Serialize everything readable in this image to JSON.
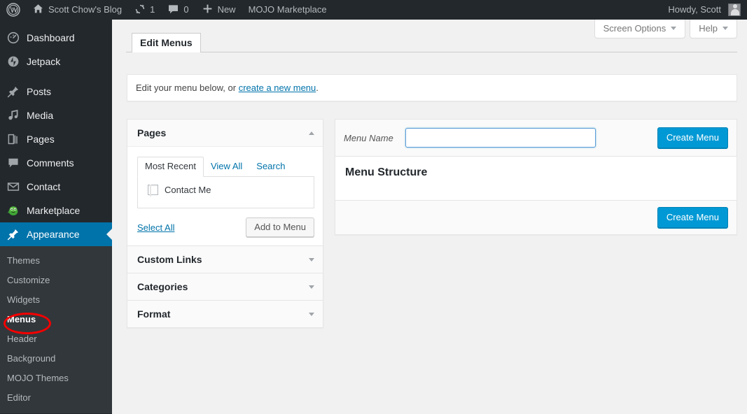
{
  "adminbar": {
    "logo_icon": "wordpress-logo-icon",
    "site_name": "Scott Chow's Blog",
    "home_icon": "home-icon",
    "updates_icon": "updates-icon",
    "updates_count": "1",
    "comments_icon": "comment-bubble-icon",
    "comments_count": "0",
    "new_icon": "plus-icon",
    "new_label": "New",
    "marketplace_label": "MOJO Marketplace",
    "howdy": "Howdy, Scott",
    "avatar_icon": "user-avatar-icon"
  },
  "sidebar": {
    "items": [
      {
        "label": "Dashboard",
        "icon": "dashboard-icon",
        "current": false
      },
      {
        "label": "Jetpack",
        "icon": "jetpack-icon",
        "current": false
      },
      {
        "label": "Posts",
        "icon": "pin-icon",
        "current": false
      },
      {
        "label": "Media",
        "icon": "media-icon",
        "current": false
      },
      {
        "label": "Pages",
        "icon": "pages-icon",
        "current": false
      },
      {
        "label": "Comments",
        "icon": "comment-icon",
        "current": false
      },
      {
        "label": "Contact",
        "icon": "envelope-icon",
        "current": false
      },
      {
        "label": "Marketplace",
        "icon": "marketplace-mascot-icon",
        "current": false
      },
      {
        "label": "Appearance",
        "icon": "paintbrush-icon",
        "current": true
      }
    ],
    "submenu": [
      {
        "label": "Themes",
        "current": false
      },
      {
        "label": "Customize",
        "current": false
      },
      {
        "label": "Widgets",
        "current": false
      },
      {
        "label": "Menus",
        "current": true
      },
      {
        "label": "Header",
        "current": false
      },
      {
        "label": "Background",
        "current": false
      },
      {
        "label": "MOJO Themes",
        "current": false
      },
      {
        "label": "Editor",
        "current": false
      }
    ],
    "annotation": {
      "target": "Menus",
      "color": "#f40000",
      "shape": "ellipse"
    }
  },
  "screen_meta": {
    "screen_options_label": "Screen Options",
    "help_label": "Help"
  },
  "tabs": [
    {
      "label": "Edit Menus",
      "active": true
    }
  ],
  "notice": {
    "text_before": "Edit your menu below, or ",
    "link": "create a new menu",
    "text_after": "."
  },
  "accordion": [
    {
      "title": "Pages",
      "open": true,
      "toggle_icon": "chevron-up-icon",
      "tabs": [
        {
          "label": "Most Recent",
          "active": true
        },
        {
          "label": "View All",
          "active": false
        },
        {
          "label": "Search",
          "active": false
        }
      ],
      "items": [
        {
          "label": "Contact Me",
          "checked": false
        }
      ],
      "select_all_label": "Select All",
      "add_to_menu_label": "Add to Menu"
    },
    {
      "title": "Custom Links",
      "open": false,
      "toggle_icon": "chevron-down-icon"
    },
    {
      "title": "Categories",
      "open": false,
      "toggle_icon": "chevron-down-icon"
    },
    {
      "title": "Format",
      "open": false,
      "toggle_icon": "chevron-down-icon"
    }
  ],
  "menu_management": {
    "menu_name_label": "Menu Name",
    "menu_name_value": "",
    "menu_name_placeholder": "",
    "create_menu_top_label": "Create Menu",
    "menu_structure_title": "Menu Structure",
    "create_menu_bottom_label": "Create Menu"
  },
  "colors": {
    "admin_bar_bg": "#23282d",
    "sidebar_bg": "#23282d",
    "submenu_bg": "#32373c",
    "current_item_bg": "#0073aa",
    "primary_button_bg": "#0099d5",
    "link_blue": "#0073aa",
    "page_bg": "#f1f1f1",
    "annotation_red": "#f40000"
  }
}
